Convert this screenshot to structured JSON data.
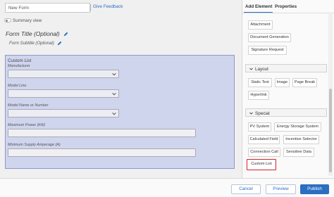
{
  "header": {
    "form_name_value": "New Form",
    "give_feedback": "Give Feedback"
  },
  "summary_view": {
    "label": "Summary view",
    "enabled": false
  },
  "form": {
    "title": "Form Title (Optional)",
    "subtitle": "Form Subtitle (Optional)",
    "custom_list": {
      "title": "Custom List",
      "fields": [
        {
          "label": "Manufacturer",
          "type": "select"
        },
        {
          "label": "Model Line",
          "type": "select"
        },
        {
          "label": "Model Name or Number",
          "type": "select"
        },
        {
          "label": "Maximum Power (kW)",
          "type": "input"
        },
        {
          "label": "Minimum Supply Amperage (A)",
          "type": "input"
        }
      ]
    }
  },
  "panel": {
    "tabs": [
      "Add Element",
      "Properties"
    ],
    "active_tab": "Add Element",
    "top_items": [
      "Attachment",
      "Document Generation",
      "Signature Request"
    ],
    "sections": [
      {
        "title": "Layout",
        "items": [
          "Static Text",
          "Image",
          "Page Break",
          "Hyperlink"
        ]
      },
      {
        "title": "Special",
        "items": [
          "PV System",
          "Energy Storage System",
          "Calculated Field",
          "Incentive Selector",
          "Connection Call",
          "Sensitive Data",
          "Custom List"
        ]
      }
    ],
    "highlighted_item": "Custom List"
  },
  "footer": {
    "cancel": "Cancel",
    "preview": "Preview",
    "publish": "Publish"
  },
  "colors": {
    "accent": "#2a6fc1",
    "highlight_border": "#d0242b",
    "custom_list_bg": "#d0d5ee"
  }
}
